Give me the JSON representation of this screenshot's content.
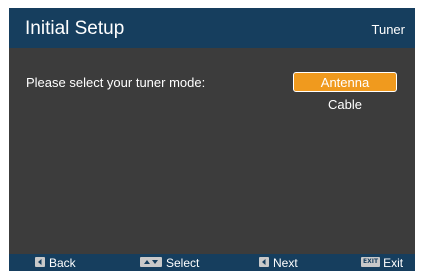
{
  "header": {
    "title": "Initial Setup",
    "subtitle": "Tuner"
  },
  "main": {
    "prompt": "Please select your tuner mode:",
    "options": [
      {
        "label": "Antenna",
        "selected": true
      },
      {
        "label": "Cable",
        "selected": false
      }
    ]
  },
  "footer": {
    "items": [
      {
        "label": "Back",
        "icon": "left-arrow-icon"
      },
      {
        "label": "Select",
        "icon": "up-down-arrows-icon"
      },
      {
        "label": "Next",
        "icon": "left-arrow-icon"
      },
      {
        "label": "Exit",
        "icon": "exit-key-icon",
        "key_text": "EXIT"
      }
    ]
  },
  "colors": {
    "header_bg": "#163e5e",
    "panel_bg": "#3c3c3c",
    "selection": "#f09a1e"
  }
}
